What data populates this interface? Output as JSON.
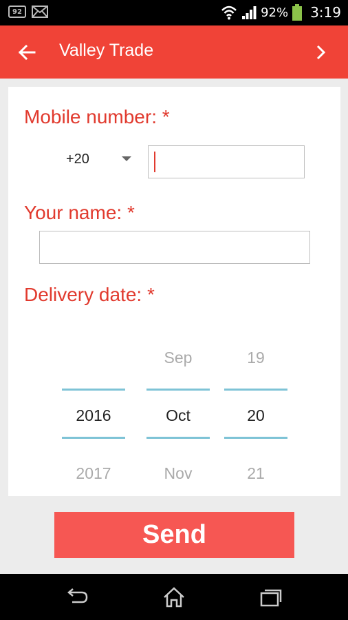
{
  "status_bar": {
    "badge": "92",
    "battery_percent": "92%",
    "time": "3:19"
  },
  "app_bar": {
    "title": "Valley Trade"
  },
  "form": {
    "mobile_label": "Mobile number: *",
    "country_code": "+20",
    "mobile_value": "",
    "name_label": "Your name: *",
    "name_value": "",
    "delivery_label": "Delivery date: *"
  },
  "date_picker": {
    "year": {
      "prev": "",
      "selected": "2016",
      "next": "2017"
    },
    "month": {
      "prev": "Sep",
      "selected": "Oct",
      "next": "Nov"
    },
    "day": {
      "prev": "19",
      "selected": "20",
      "next": "21"
    }
  },
  "send_label": "Send",
  "colors": {
    "app_bar": "#f04337",
    "label_red": "#e13a2e",
    "send_button": "#f65753",
    "picker_line": "#7ec3d6"
  }
}
